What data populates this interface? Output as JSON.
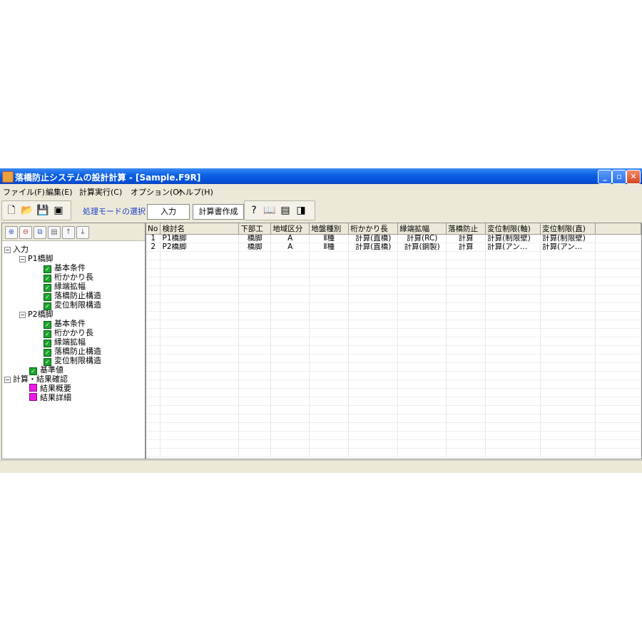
{
  "app": {
    "title": "落橋防止システムの設計計算 - [Sample.F9R]"
  },
  "menu": [
    "ファイル(F)",
    "編集(E)",
    "計算実行(C)",
    "オプション(O)",
    "ヘルプ(H)"
  ],
  "toolbar": {
    "mode_label": "処理モードの選択",
    "mode_input": "入力",
    "mode_report": "計算書作成"
  },
  "tree": {
    "root_input": "入力",
    "p1": "P1橋脚",
    "p1_items": [
      "基本条件",
      "桁かかり長",
      "縁端拡幅",
      "落橋防止構造",
      "変位制限構造"
    ],
    "p2": "P2橋脚",
    "p2_items": [
      "基本条件",
      "桁かかり長",
      "縁端拡幅",
      "落橋防止構造",
      "変位制限構造"
    ],
    "standard": "基準値",
    "root_calc": "計算・結果確認",
    "calc_items": [
      "結果概要",
      "結果詳細"
    ]
  },
  "grid": {
    "headers": [
      "No",
      "検討名",
      "下部工",
      "地域区分",
      "地盤種別",
      "桁かかり長",
      "縁端拡幅",
      "落橋防止",
      "変位制限(軸)",
      "変位制限(直)"
    ],
    "rows": [
      [
        "1",
        "P1橋脚",
        "橋脚",
        "A",
        "Ⅱ種",
        "計算(直橋)",
        "計算(RC)",
        "計算",
        "計算(制限壁)",
        "計算(制限壁)"
      ],
      [
        "2",
        "P2橋脚",
        "橋脚",
        "A",
        "Ⅱ種",
        "計算(直橋)",
        "計算(鋼製)",
        "計算",
        "計算(アン…",
        "計算(アン…"
      ]
    ]
  }
}
